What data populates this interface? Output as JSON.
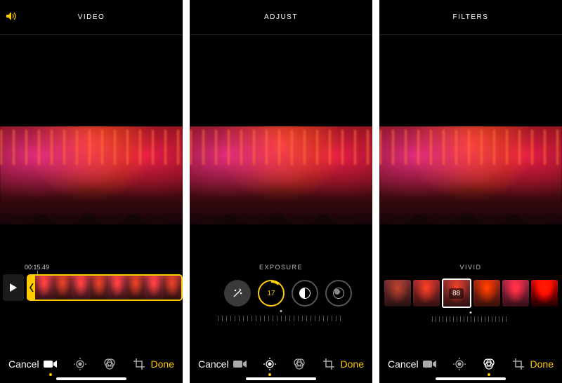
{
  "panels": [
    {
      "tab": "VIDEO",
      "sound_on": true,
      "timestamp": "00:15.49",
      "cancel": "Cancel",
      "done": "Done",
      "active_tool": "video"
    },
    {
      "tab": "ADJUST",
      "adjust_label": "EXPOSURE",
      "exposure_value": "17",
      "cancel": "Cancel",
      "done": "Done",
      "active_tool": "adjust"
    },
    {
      "tab": "FILTERS",
      "filter_label": "VIVID",
      "filter_intensity": "88",
      "cancel": "Cancel",
      "done": "Done",
      "active_tool": "filters"
    }
  ]
}
